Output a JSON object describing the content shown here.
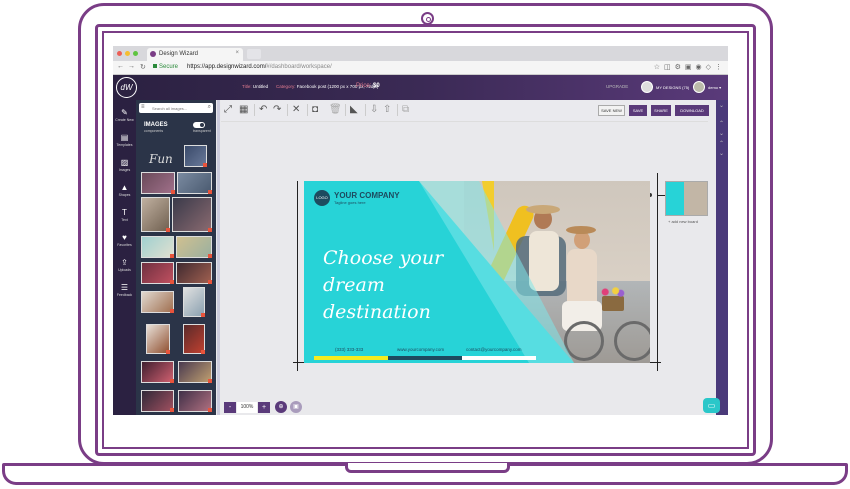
{
  "browser": {
    "tab_title": "Design Wizard",
    "secure_label": "Secure",
    "url_host": "https://app.designwizard.com/",
    "url_path": "#/dashboard/workspace/"
  },
  "header": {
    "logo_text": "dW",
    "title_label": "Title:",
    "title_value": "Untitled",
    "category_label": "Category:",
    "category_value": "Facebook post (1200 px x 700 px, 72dpi)",
    "price_label": "Price:",
    "price_value": "$0",
    "upgrade": "UPGRADE",
    "my_designs": "MY DESIGNS (75)",
    "username": "demo"
  },
  "leftnav": [
    {
      "label": "Create New",
      "icon": "pencil-icon"
    },
    {
      "label": "Templates",
      "icon": "document-icon"
    },
    {
      "label": "Images",
      "icon": "image-icon"
    },
    {
      "label": "Shapes",
      "icon": "shapes-icon"
    },
    {
      "label": "Text",
      "icon": "text-icon"
    },
    {
      "label": "Favorites",
      "icon": "heart-icon"
    },
    {
      "label": "Uploads",
      "icon": "upload-icon"
    },
    {
      "label": "Feedback",
      "icon": "feedback-icon"
    }
  ],
  "panel": {
    "search_placeholder": "Search all images...",
    "title": "IMAGES",
    "sub1": "components",
    "sub2": "transparent",
    "fun_text": "Fun"
  },
  "actions": {
    "save_new": "SAVE NEW",
    "save": "SAVE",
    "share": "SHARE",
    "download": "DOWNLOAD"
  },
  "canvas": {
    "logo": "LOGO",
    "company": "YOUR COMPANY",
    "tagline": "Tagline goes here",
    "headline1": "Choose your",
    "headline2": "dream destination",
    "phone": "(333) 333-333",
    "website": "www.yourcompany.com",
    "email": "contact@yourcompany.com",
    "colors": {
      "teal": "#27d3d7",
      "navy": "#1d4b5f",
      "yellow": "#f2cd2e"
    }
  },
  "boards": {
    "add_board": "+ add new board"
  },
  "zoom": {
    "minus": "-",
    "value": "100%",
    "plus": "+"
  }
}
